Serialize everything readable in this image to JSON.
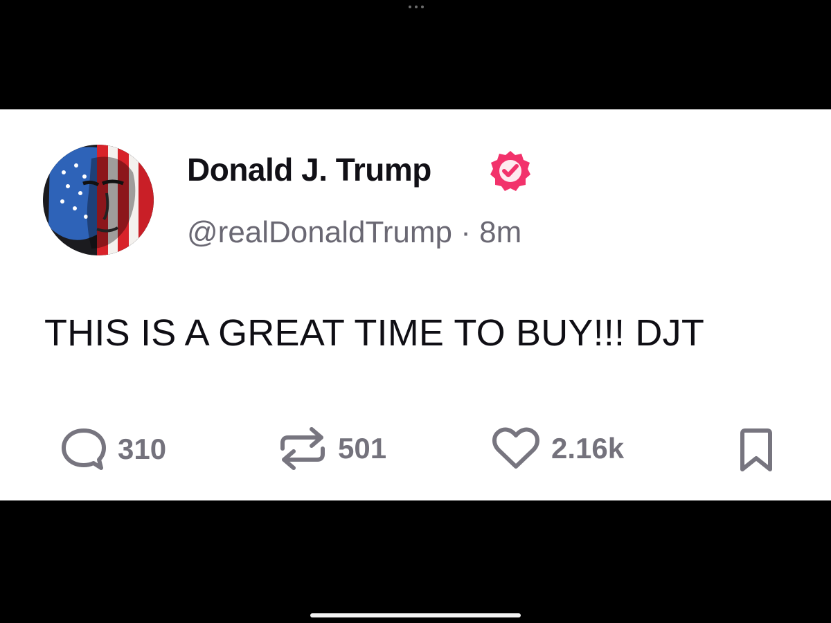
{
  "post": {
    "author": {
      "display_name": "Donald J. Trump",
      "verified": true,
      "handle": "@realDonaldTrump",
      "separator": "·",
      "age": "8m",
      "avatar_icon": "flag-portrait-avatar"
    },
    "text": "THIS IS A GREAT TIME TO BUY!!! DJT",
    "actions": {
      "replies": "310",
      "reposts": "501",
      "likes": "2.16k",
      "icons": [
        "comment-icon",
        "repost-icon",
        "heart-icon",
        "bookmark-icon"
      ]
    }
  },
  "colors": {
    "background": "#000000",
    "card": "#ffffff",
    "text": "#0f0e14",
    "muted": "#6a6873",
    "verified": "#f2326b"
  }
}
